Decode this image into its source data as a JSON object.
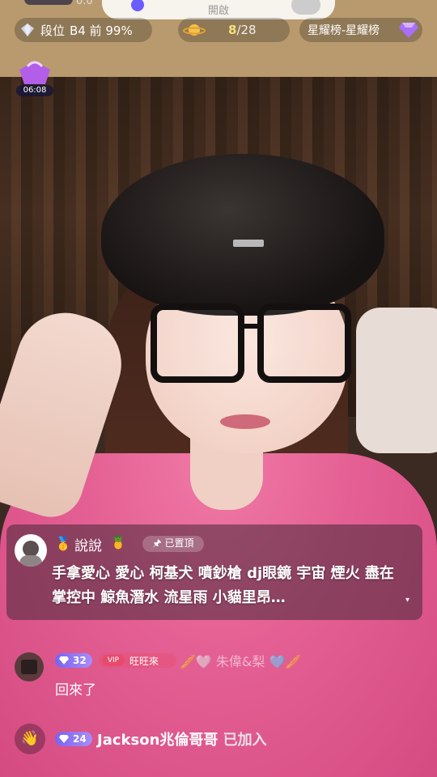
{
  "top": {
    "notification_text": "開啟",
    "partial_count": "0.0",
    "rank_label": "段位",
    "rank_value": "B4 前 99%",
    "planet_progress": "8",
    "planet_total": "/28",
    "star_rank_label": "星耀榜-星耀榜",
    "timer": "06:08"
  },
  "pinned": {
    "username": "說說",
    "medal_icon": "medal-icon",
    "pin_tag": "🖈 已置頂",
    "message": "手拿愛心 愛心 柯基犬 噴鈔槍 dj眼鏡 宇宙 煙火 盡在掌控中 鯨魚潛水 流星雨 小貓里昂…",
    "expand_icon": "▾"
  },
  "chat": [
    {
      "level": "32",
      "fan_badge_heart": "VIP",
      "fan_badge_name": "旺旺來",
      "faded_name": "🥖🤍 朱偉&梨 🩵🥖",
      "message": "回來了"
    }
  ],
  "join": {
    "level": "24",
    "username": "Jackson兆倫哥哥",
    "suffix": " 已加入"
  },
  "colors": {
    "level_badge": "#7a63f0",
    "planet_count": "#f6e07a",
    "sweater": "#e45f93"
  }
}
